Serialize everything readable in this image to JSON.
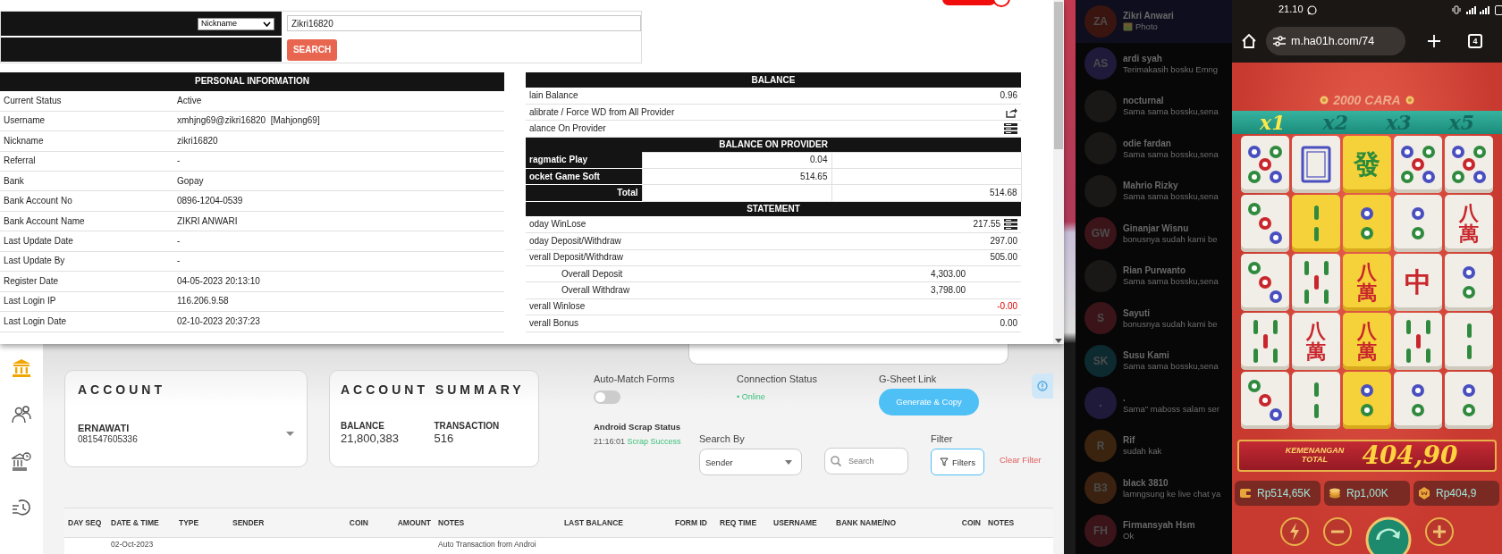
{
  "popup": {
    "search": {
      "field": "Nickname",
      "value": "Zikri16820",
      "button": "SEARCH"
    },
    "personal": {
      "title": "PERSONAL INFORMATION",
      "rows": [
        {
          "label": "Current Status",
          "value": "Active"
        },
        {
          "label": "Username",
          "value": "xmhjng69@zikri16820  [Mahjong69]"
        },
        {
          "label": "Nickname",
          "value": "zikri16820"
        },
        {
          "label": "Referral",
          "value": "-"
        },
        {
          "label": "Bank",
          "value": "Gopay"
        },
        {
          "label": "Bank Account No",
          "value": "0896-1204-0539"
        },
        {
          "label": "Bank Account Name",
          "value": "ZIKRI ANWARI"
        },
        {
          "label": "Last Update Date",
          "value": "-"
        },
        {
          "label": "Last Update By",
          "value": "-"
        },
        {
          "label": "Register Date",
          "value": "04-05-2023 20:13:10"
        },
        {
          "label": "Last Login IP",
          "value": "116.206.9.58"
        },
        {
          "label": "Last Login Date",
          "value": "02-10-2023 20:37:23"
        }
      ]
    },
    "balance": {
      "title": "BALANCE",
      "rows": [
        {
          "kind": "value",
          "label": "lain Balance",
          "value": "0.96"
        },
        {
          "kind": "share",
          "label": "alibrate / Force WD from All Provider"
        },
        {
          "kind": "list",
          "label": "alance On Provider"
        }
      ]
    },
    "provider": {
      "title": "BALANCE ON PROVIDER",
      "rows": [
        {
          "name": "ragmatic Play",
          "value": "0.04"
        },
        {
          "name": "ocket Game Soft",
          "value": "514.65"
        }
      ],
      "total_label": "Total",
      "total": "514.68"
    },
    "statement": {
      "title": "STATEMENT",
      "rows": [
        {
          "kind": "main",
          "label": "oday WinLose",
          "value": "217.55",
          "menu": true,
          "negative": false
        },
        {
          "kind": "main",
          "label": "oday Deposit/Withdraw",
          "value": "297.00",
          "menu": false,
          "negative": false
        },
        {
          "kind": "main",
          "label": "verall Deposit/Withdraw",
          "value": "505.00",
          "menu": false,
          "negative": false
        },
        {
          "kind": "sub",
          "label": "Overall Deposit",
          "value": "4,303.00",
          "menu": false,
          "negative": false
        },
        {
          "kind": "sub",
          "label": "Overall Withdraw",
          "value": "3,798.00",
          "menu": false,
          "negative": false
        },
        {
          "kind": "main",
          "label": "verall Winlose",
          "value": "-0.00",
          "menu": false,
          "negative": true
        },
        {
          "kind": "main",
          "label": "verall Bonus",
          "value": "0.00",
          "menu": false,
          "negative": false
        }
      ]
    }
  },
  "dashboard": {
    "sidebar": [
      {
        "kind": "bank",
        "selected": true
      },
      {
        "kind": "people",
        "selected": false
      },
      {
        "kind": "bankclock",
        "selected": false
      },
      {
        "kind": "history",
        "selected": false
      }
    ],
    "account": {
      "title": "ACCOUNT",
      "name": "ERNAWATI",
      "number": "081547605336"
    },
    "summary": {
      "title": "ACCOUNT SUMMARY",
      "stats": [
        {
          "label": "BALANCE",
          "value": "21,800,383"
        },
        {
          "label": "TRANSACTION",
          "value": "516"
        }
      ]
    },
    "auto_match": {
      "label": "Auto-Match Forms",
      "on": false
    },
    "connection": {
      "label": "Connection Status",
      "status": "• Online"
    },
    "gsheet": {
      "label": "G-Sheet Link",
      "button": "Generate & Copy"
    },
    "scrap": {
      "label": "Android Scrap Status",
      "time": "21:16:01",
      "result": "Scrap Success"
    },
    "search_by": {
      "label": "Search By",
      "value": "Sender"
    },
    "search": {
      "placeholder": "Search"
    },
    "filter": {
      "label": "Filter",
      "button": "Filters",
      "clear": "Clear Filter"
    },
    "table": {
      "columns": [
        "DAY SEQ",
        "DATE & TIME",
        "TYPE",
        "SENDER",
        "COIN",
        "AMOUNT",
        "NOTES",
        "LAST BALANCE",
        "FORM ID",
        "REQ TIME",
        "USERNAME",
        "BANK NAME/NO",
        "COIN",
        "NOTES"
      ],
      "rows": [
        {
          "date_time": "02-Oct-2023",
          "notes": "Auto Transaction from Androi"
        }
      ]
    }
  },
  "chats": [
    {
      "kind": "initials",
      "initials": "ZA",
      "color": "#3a1510",
      "name": "Zikri Anwari",
      "message": "Photo",
      "media": true,
      "selected": true
    },
    {
      "kind": "initials",
      "initials": "AS",
      "color": "#1f1a3a",
      "name": "ardi syah",
      "message": "Terimakasih bosku Emng",
      "media": false,
      "selected": false
    },
    {
      "kind": "photo",
      "name": "nocturnal",
      "message": "Sama sama bossku,sena",
      "media": false,
      "selected": false
    },
    {
      "kind": "photo",
      "name": "odie fardan",
      "message": "Sama sama bossku,sena",
      "media": false,
      "selected": false
    },
    {
      "kind": "photo",
      "name": "Mahrio Rizky",
      "message": "Sama sama bossku,sena",
      "media": false,
      "selected": false
    },
    {
      "kind": "initials",
      "initials": "GW",
      "color": "#3a1419",
      "name": "Ginanjar Wisnu",
      "message": "bonusnya sudah kami be",
      "media": false,
      "selected": false
    },
    {
      "kind": "photo",
      "name": "Rian Purwanto",
      "message": "Sama sama bossku,sena",
      "media": false,
      "selected": false
    },
    {
      "kind": "initials",
      "initials": "S",
      "color": "#3a1419",
      "name": "Sayuti",
      "message": "bonusnya sudah kami be",
      "media": false,
      "selected": false
    },
    {
      "kind": "initials",
      "initials": "SK",
      "color": "#0d2a30",
      "name": "Susu Kami",
      "message": "Sama sama bossku,sena",
      "media": false,
      "selected": false
    },
    {
      "kind": "initials",
      "initials": ".",
      "color": "#1f1a3a",
      "name": ".",
      "message": "Sama\" maboss salam ser",
      "media": false,
      "selected": false
    },
    {
      "kind": "initials",
      "initials": "R",
      "color": "#3a2410",
      "name": "Rif",
      "message": "sudah kak",
      "media": false,
      "selected": false
    },
    {
      "kind": "initials",
      "initials": "B3",
      "color": "#3a2110",
      "name": "black 3810",
      "message": "lamngsung ke live chat ya",
      "media": false,
      "selected": false
    },
    {
      "kind": "initials",
      "initials": "FH",
      "color": "#3a1419",
      "name": "Firmansyah Hsm",
      "message": "Ok",
      "media": false,
      "selected": false
    }
  ],
  "phone": {
    "time": "21.10",
    "url": "m.ha01h.com/74",
    "tabs": "4",
    "game": {
      "ways": "2000 CARA",
      "multipliers": [
        {
          "label": "x1",
          "selected": true
        },
        {
          "label": "x2",
          "selected": false
        },
        {
          "label": "x3",
          "selected": false
        },
        {
          "label": "x5",
          "selected": false
        }
      ],
      "reels": [
        [
          {
            "kind": "dots5",
            "gold": false
          },
          {
            "kind": "dots3",
            "gold": false
          },
          {
            "kind": "dots3",
            "gold": false
          },
          {
            "kind": "bamboo5",
            "gold": false
          },
          {
            "kind": "dots3",
            "gold": false
          }
        ],
        [
          {
            "kind": "frame",
            "gold": false
          },
          {
            "kind": "bamboo2",
            "gold": true
          },
          {
            "kind": "bamboo5",
            "gold": false
          },
          {
            "kind": "glyph",
            "text": "八萬",
            "color": "#c8262c",
            "gold": false
          },
          {
            "kind": "bamboo2",
            "gold": false
          }
        ],
        [
          {
            "kind": "glyph",
            "text": "發",
            "color": "#2e8b3a",
            "gold": true
          },
          {
            "kind": "dots2",
            "gold": true
          },
          {
            "kind": "glyph",
            "text": "八萬",
            "color": "#c8262c",
            "gold": true
          },
          {
            "kind": "glyph",
            "text": "八萬",
            "color": "#c8262c",
            "gold": true
          },
          {
            "kind": "dots2",
            "gold": true
          }
        ],
        [
          {
            "kind": "dots5",
            "gold": false
          },
          {
            "kind": "dots2",
            "gold": false
          },
          {
            "kind": "glyph",
            "text": "中",
            "color": "#c8262c",
            "gold": false
          },
          {
            "kind": "bamboo5",
            "gold": false
          },
          {
            "kind": "dots2",
            "gold": false
          }
        ],
        [
          {
            "kind": "dots5",
            "gold": false
          },
          {
            "kind": "glyph",
            "text": "八萬",
            "color": "#c8262c",
            "gold": false
          },
          {
            "kind": "dots2",
            "gold": false
          },
          {
            "kind": "bamboo2",
            "gold": false
          },
          {
            "kind": "dots2",
            "gold": false
          }
        ]
      ],
      "win_label": "KEMENANGAN TOTAL",
      "win": "404,90",
      "stats": [
        {
          "kind": "balance",
          "value": "Rp514,65K"
        },
        {
          "kind": "bet",
          "value": "Rp1,00K"
        },
        {
          "kind": "win",
          "value": "Rp404,9"
        }
      ]
    }
  }
}
